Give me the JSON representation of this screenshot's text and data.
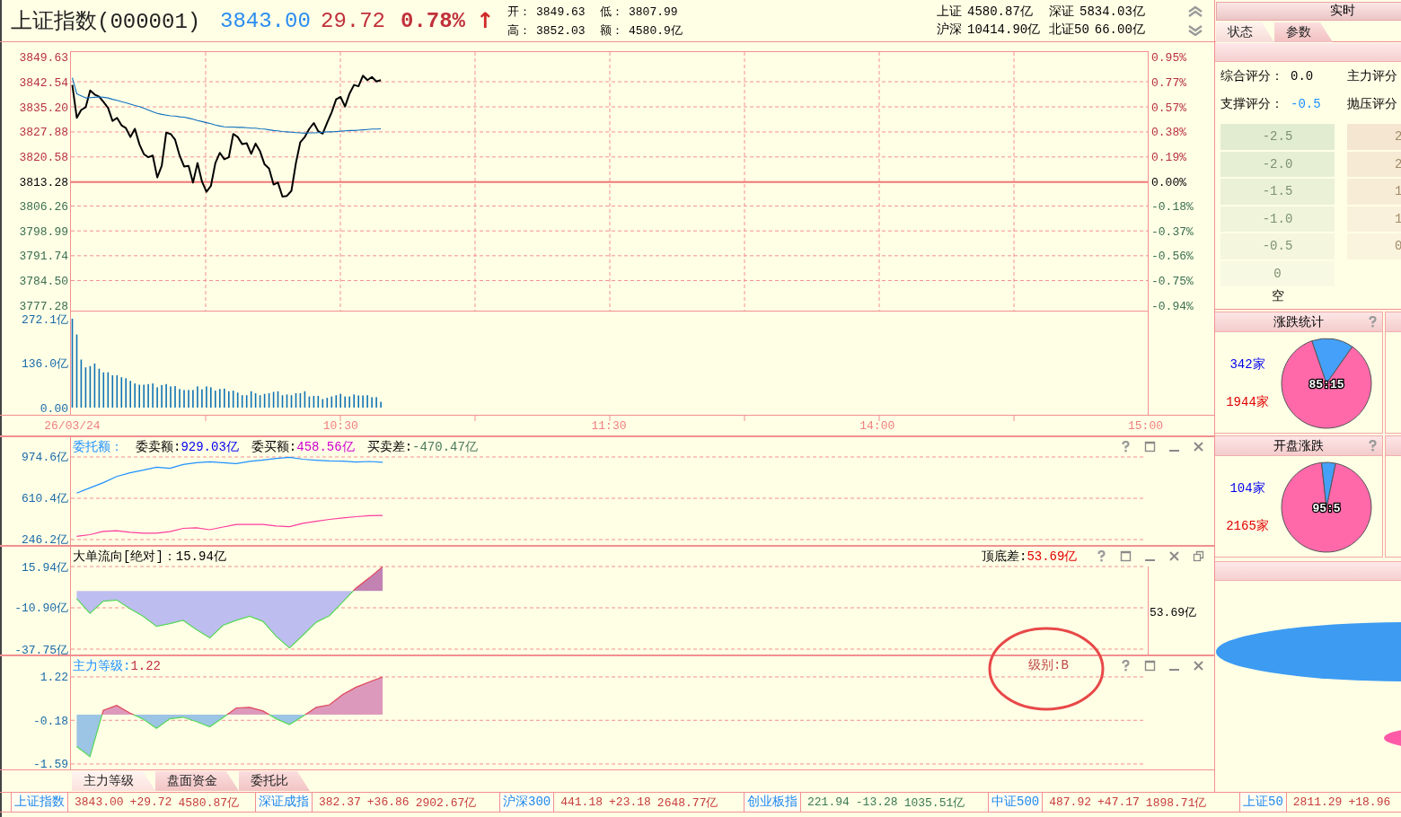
{
  "header": {
    "title": "上证指数(000001)",
    "price": "3843.00",
    "change": "29.72",
    "change_pct": "0.78%",
    "arrow": "↑",
    "stats": [
      {
        "label": "开：",
        "value": "3849.63"
      },
      {
        "label": "低：",
        "value": "3807.99"
      },
      {
        "label": "高：",
        "value": "3852.03"
      },
      {
        "label": "额：",
        "value": "4580.9亿"
      }
    ],
    "turnover": [
      {
        "label": "上证",
        "value": "4580.87亿"
      },
      {
        "label": "深证",
        "value": "5834.03亿"
      },
      {
        "label": "沪深",
        "value": "10414.90亿"
      },
      {
        "label": "北证50",
        "value": "66.00亿"
      }
    ]
  },
  "price_chart": {
    "right_axis": [
      "0.95%",
      "0.77%",
      "0.57%",
      "0.38%",
      "0.19%",
      "0.00%",
      "-0.18%",
      "-0.37%",
      "-0.56%",
      "-0.75%",
      "-0.94%"
    ],
    "chart_data": {
      "type": "line",
      "grid": true,
      "ylim": [
        3775.71,
        3851.33
      ],
      "yticks": [
        {
          "value": 3849.63,
          "label": "3849.63"
        },
        {
          "value": 3842.54,
          "label": "3842.54"
        },
        {
          "value": 3835.2,
          "label": "3835.20"
        },
        {
          "value": 3827.88,
          "label": "3827.88"
        },
        {
          "value": 3820.58,
          "label": "3820.58"
        },
        {
          "value": 3813.28,
          "label": "3813.28"
        },
        {
          "value": 3806.26,
          "label": "3806.26"
        },
        {
          "value": 3798.99,
          "label": "3798.99"
        },
        {
          "value": 3791.74,
          "label": "3791.74"
        },
        {
          "value": 3784.5,
          "label": "3784.50"
        },
        {
          "value": 3777.28,
          "label": "3777.28"
        }
      ],
      "ref_lines": [
        {
          "axis": "y",
          "value": 3813.28
        }
      ],
      "categories": [
        null,
        null,
        null,
        null,
        null,
        null,
        null,
        null,
        null,
        null,
        null,
        null,
        null,
        null,
        null,
        null,
        null,
        null,
        null,
        null,
        null,
        null,
        null,
        null,
        null,
        null,
        null,
        null,
        null,
        null,
        null,
        null,
        null,
        null,
        null,
        null,
        null,
        null,
        null,
        null,
        null,
        null,
        null,
        null,
        null,
        null,
        null,
        null,
        null,
        null,
        null,
        null,
        null,
        null,
        null,
        null,
        null,
        null,
        null,
        null,
        null,
        null,
        null,
        null,
        null,
        null,
        null,
        null,
        null,
        null,
        null,
        null,
        null,
        null,
        null,
        null,
        null,
        null,
        null,
        null,
        null,
        null,
        null,
        null,
        null,
        null,
        null,
        null,
        null,
        null,
        null,
        null,
        null,
        null,
        null,
        null,
        null,
        null,
        null,
        null,
        null,
        null,
        null,
        null,
        null,
        null,
        null,
        null,
        null,
        null,
        null,
        null,
        null,
        null,
        null,
        null,
        null,
        null,
        null,
        null,
        null,
        null,
        null,
        null,
        null,
        null,
        null,
        null,
        null,
        null,
        null,
        null,
        null,
        null,
        null,
        null,
        null,
        null,
        null,
        null,
        null,
        null,
        null,
        null,
        null,
        null,
        null,
        null,
        null,
        null,
        null,
        null,
        null,
        null,
        null,
        null,
        null,
        null,
        null,
        null,
        null,
        null,
        null,
        null,
        null,
        null,
        null,
        null,
        null,
        null,
        null,
        null,
        null,
        null,
        null,
        null,
        null,
        null,
        null,
        null,
        null,
        null,
        null,
        null,
        null,
        null,
        null,
        null,
        null,
        null,
        null,
        null,
        null,
        null,
        null,
        null,
        null,
        null,
        null,
        null,
        null,
        null,
        null,
        null,
        null,
        null,
        null,
        null,
        null,
        null,
        null,
        null,
        null,
        null,
        null,
        null,
        null,
        null,
        null,
        null,
        null,
        null,
        null,
        null,
        null,
        null,
        null,
        null,
        null,
        null,
        null,
        null,
        null,
        null,
        null,
        null,
        null,
        null,
        null,
        null,
        null
      ],
      "series": [
        {
          "color": "#000000",
          "values": [
            3841.6,
            3832.0,
            3834.3,
            3835.1,
            3840.0,
            3838.8,
            3838.2,
            3836.6,
            3834.9,
            3831.1,
            3832.0,
            3829.8,
            3829.0,
            3826.4,
            3828.8,
            3824.3,
            3821.4,
            3820.5,
            3821.0,
            3814.6,
            3818.0,
            3827.7,
            3827.3,
            3825.6,
            3821.0,
            3817.8,
            3818.0,
            3813.1,
            3818.8,
            3813.4,
            3810.4,
            3812.1,
            3818.8,
            3821.8,
            3819.9,
            3820.5,
            3827.3,
            3826.4,
            3824.3,
            3824.6,
            3821.5,
            3824.5,
            3822.2,
            3818.4,
            3817.2,
            3812.5,
            3813.1,
            3809.0,
            3809.2,
            3810.7,
            3818.8,
            3824.9,
            3826.4,
            3828.8,
            3830.5,
            3828.1,
            3827.4,
            3830.6,
            3833.6,
            3837.4,
            3838.1,
            3835.3,
            3839.1,
            3841.6,
            3841.2,
            3844.3,
            3843.0,
            3843.9,
            3842.6,
            3843.0,
            null,
            null,
            null,
            null,
            null,
            null,
            null,
            null,
            null,
            null,
            null,
            null,
            null,
            null,
            null,
            null,
            null,
            null,
            null,
            null,
            null,
            null,
            null,
            null,
            null,
            null,
            null,
            null,
            null,
            null,
            null,
            null,
            null,
            null,
            null,
            null,
            null,
            null,
            null,
            null,
            null,
            null,
            null,
            null,
            null,
            null,
            null,
            null,
            null,
            null,
            null,
            null,
            null,
            null,
            null,
            null,
            null,
            null,
            null,
            null,
            null,
            null,
            null,
            null,
            null,
            null,
            null,
            null,
            null,
            null,
            null,
            null,
            null,
            null,
            null,
            null,
            null,
            null,
            null,
            null,
            null,
            null,
            null,
            null,
            null,
            null,
            null,
            null,
            null,
            null,
            null,
            null,
            null,
            null,
            null,
            null,
            null,
            null,
            null,
            null,
            null,
            null,
            null,
            null,
            null,
            null,
            null,
            null,
            null,
            null,
            null,
            null,
            null,
            null,
            null,
            null,
            null,
            null,
            null,
            null,
            null,
            null,
            null,
            null,
            null,
            null,
            null,
            null,
            null,
            null,
            null,
            null,
            null,
            null,
            null,
            null,
            null,
            null,
            null,
            null,
            null,
            null,
            null,
            null,
            null,
            null,
            null,
            null,
            null,
            null,
            null,
            null,
            null,
            null,
            null,
            null,
            null,
            null,
            null,
            null,
            null,
            null,
            null,
            null,
            null,
            null,
            null,
            null,
            null,
            null,
            null
          ]
        },
        {
          "color": "#1070c0",
          "values": [
            3843.7,
            3839.0,
            3838.4,
            3837.8,
            3837.9,
            3838.0,
            3838.1,
            3838.0,
            3837.8,
            3837.4,
            3837.1,
            3836.7,
            3836.4,
            3836.0,
            3835.6,
            3835.3,
            3834.8,
            3834.3,
            3833.8,
            3833.3,
            3833.0,
            3832.8,
            3832.6,
            3832.5,
            3832.3,
            3832.2,
            3831.9,
            3831.6,
            3831.2,
            3830.9,
            3830.6,
            3830.3,
            3829.9,
            3829.6,
            3829.4,
            3829.3,
            3829.3,
            3829.2,
            3829.2,
            3829.1,
            3829.0,
            3829.0,
            3828.8,
            3828.7,
            3828.5,
            3828.3,
            3828.2,
            3828.0,
            3827.9,
            3827.8,
            3827.7,
            3827.6,
            3827.5,
            3827.6,
            3827.6,
            3827.7,
            3827.8,
            3827.9,
            3827.9,
            3828.0,
            3828.1,
            3828.2,
            3828.3,
            3828.3,
            3828.4,
            3828.5,
            3828.6,
            3828.7,
            3828.7,
            3828.8,
            null,
            null,
            null,
            null,
            null,
            null,
            null,
            null,
            null,
            null,
            null,
            null,
            null,
            null,
            null,
            null,
            null,
            null,
            null,
            null,
            null,
            null,
            null,
            null,
            null,
            null,
            null,
            null,
            null,
            null,
            null,
            null,
            null,
            null,
            null,
            null,
            null,
            null,
            null,
            null,
            null,
            null,
            null,
            null,
            null,
            null,
            null,
            null,
            null,
            null,
            null,
            null,
            null,
            null,
            null,
            null,
            null,
            null,
            null,
            null,
            null,
            null,
            null,
            null,
            null,
            null,
            null,
            null,
            null,
            null,
            null,
            null,
            null,
            null,
            null,
            null,
            null,
            null,
            null,
            null,
            null,
            null,
            null,
            null,
            null,
            null,
            null,
            null,
            null,
            null,
            null,
            null,
            null,
            null,
            null,
            null,
            null,
            null,
            null,
            null,
            null,
            null,
            null,
            null,
            null,
            null,
            null,
            null,
            null,
            null,
            null,
            null,
            null,
            null,
            null,
            null,
            null,
            null,
            null,
            null,
            null,
            null,
            null,
            null,
            null,
            null,
            null,
            null,
            null,
            null,
            null,
            null,
            null,
            null,
            null,
            null,
            null,
            null,
            null,
            null,
            null,
            null,
            null,
            null,
            null,
            null,
            null,
            null,
            null,
            null,
            null,
            null,
            null,
            null,
            null,
            null,
            null,
            null,
            null,
            null,
            null,
            null,
            null,
            null,
            null,
            null,
            null,
            null,
            null,
            null,
            null
          ]
        }
      ]
    }
  },
  "volume_chart": {
    "chart_data": {
      "type": "bar",
      "ylim": [
        0,
        272.1
      ],
      "yticks": [
        {
          "value": 272.1,
          "label": "272.1亿"
        },
        {
          "value": 136,
          "label": "136.0亿"
        },
        {
          "value": 0,
          "label": "0.00"
        }
      ],
      "categories": [
        "26/03/24",
        null,
        null,
        null,
        null,
        null,
        null,
        null,
        null,
        null,
        null,
        null,
        null,
        null,
        null,
        null,
        null,
        null,
        null,
        null,
        null,
        null,
        null,
        null,
        null,
        null,
        null,
        null,
        null,
        null,
        null,
        null,
        null,
        null,
        null,
        null,
        null,
        null,
        null,
        null,
        null,
        null,
        null,
        null,
        null,
        null,
        null,
        null,
        null,
        null,
        null,
        null,
        null,
        null,
        null,
        null,
        null,
        null,
        null,
        null,
        "10:30",
        null,
        null,
        null,
        null,
        null,
        null,
        null,
        null,
        null,
        null,
        null,
        null,
        null,
        null,
        null,
        null,
        null,
        null,
        null,
        null,
        null,
        null,
        null,
        null,
        null,
        null,
        null,
        null,
        null,
        null,
        null,
        null,
        null,
        null,
        null,
        null,
        null,
        null,
        null,
        null,
        null,
        null,
        null,
        null,
        null,
        null,
        null,
        null,
        null,
        null,
        null,
        null,
        null,
        null,
        null,
        null,
        null,
        null,
        null,
        "11:30",
        null,
        null,
        null,
        null,
        null,
        null,
        null,
        null,
        null,
        null,
        null,
        null,
        null,
        null,
        null,
        null,
        null,
        null,
        null,
        null,
        null,
        null,
        null,
        null,
        null,
        null,
        null,
        null,
        null,
        null,
        null,
        null,
        null,
        null,
        null,
        null,
        null,
        null,
        null,
        null,
        null,
        null,
        null,
        null,
        null,
        null,
        null,
        null,
        null,
        null,
        null,
        null,
        null,
        null,
        null,
        null,
        null,
        null,
        null,
        "14:00",
        null,
        null,
        null,
        null,
        null,
        null,
        null,
        null,
        null,
        null,
        null,
        null,
        null,
        null,
        null,
        null,
        null,
        null,
        null,
        null,
        null,
        null,
        null,
        null,
        null,
        null,
        null,
        null,
        null,
        null,
        null,
        null,
        null,
        null,
        null,
        null,
        null,
        null,
        null,
        null,
        null,
        null,
        null,
        null,
        null,
        null,
        null,
        null,
        null,
        null,
        null,
        null,
        null,
        null,
        null,
        null,
        null,
        null,
        null,
        "15:00"
      ],
      "series": [
        {
          "color": "#0f72b4",
          "values": [
            272,
            224,
            147,
            123,
            127,
            135,
            119,
            108,
            108,
            99,
            99,
            93,
            90,
            82,
            74,
            70,
            70,
            72,
            74,
            62,
            69,
            72,
            65,
            66,
            57,
            54,
            54,
            54,
            65,
            56,
            65,
            62,
            52,
            57,
            58,
            50,
            52,
            46,
            38,
            38,
            50,
            44,
            38,
            42,
            44,
            48,
            50,
            38,
            40,
            38,
            44,
            44,
            50,
            34,
            36,
            36,
            26,
            30,
            34,
            38,
            42,
            34,
            34,
            40,
            37,
            37,
            38,
            32,
            32,
            18,
            null,
            null,
            null,
            null,
            null,
            null,
            null,
            null,
            null,
            null,
            null,
            null,
            null,
            null,
            null,
            null,
            null,
            null,
            null,
            null,
            null,
            null,
            null,
            null,
            null,
            null,
            null,
            null,
            null,
            null,
            null,
            null,
            null,
            null,
            null,
            null,
            null,
            null,
            null,
            null,
            null,
            null,
            null,
            null,
            null,
            null,
            null,
            null,
            null,
            null,
            null,
            null,
            null,
            null,
            null,
            null,
            null,
            null,
            null,
            null,
            null,
            null,
            null,
            null,
            null,
            null,
            null,
            null,
            null,
            null,
            null,
            null,
            null,
            null,
            null,
            null,
            null,
            null,
            null,
            null,
            null,
            null,
            null,
            null,
            null,
            null,
            null,
            null,
            null,
            null,
            null,
            null,
            null,
            null,
            null,
            null,
            null,
            null,
            null,
            null,
            null,
            null,
            null,
            null,
            null,
            null,
            null,
            null,
            null,
            null,
            null,
            null,
            null,
            null,
            null,
            null,
            null,
            null,
            null,
            null,
            null,
            null,
            null,
            null,
            null,
            null,
            null,
            null,
            null,
            null,
            null,
            null,
            null,
            null,
            null,
            null,
            null,
            null,
            null,
            null,
            null,
            null,
            null,
            null,
            null,
            null,
            null,
            null,
            null,
            null,
            null,
            null,
            null,
            null,
            null,
            null,
            null,
            null,
            null,
            null,
            null,
            null,
            null,
            null,
            null,
            null,
            null,
            null,
            null,
            null,
            null
          ]
        }
      ]
    }
  },
  "order_panel": {
    "header": [
      {
        "kind": "label",
        "text": "委托额：",
        "color": "#1e90ff"
      },
      {
        "kind": "label",
        "text": "委卖额:",
        "color": "#000000"
      },
      {
        "kind": "value",
        "text": "929.03亿",
        "color": "#0000ee"
      },
      {
        "kind": "label",
        "text": "委买额:",
        "color": "#000000"
      },
      {
        "kind": "value",
        "text": "458.56亿",
        "color": "#cc00cc"
      },
      {
        "kind": "label",
        "text": "买卖差:",
        "color": "#000000"
      },
      {
        "kind": "value",
        "text": "-470.47亿",
        "color": "#4a7a5a"
      }
    ],
    "controls": [
      {
        "kind": "help"
      },
      {
        "kind": "maximize"
      },
      {
        "kind": "minimize"
      },
      {
        "kind": "close"
      }
    ],
    "chart_data": {
      "type": "line",
      "grid": true,
      "ylim": [
        194.7,
        1152.7
      ],
      "yticks": [
        {
          "value": 974.6,
          "label": "974.6亿"
        },
        {
          "value": 610.4,
          "label": "610.4亿"
        },
        {
          "value": 246.2,
          "label": "246.2亿"
        }
      ],
      "categories": [
        null,
        null,
        null,
        null,
        null,
        null,
        null,
        null,
        null,
        null,
        null,
        null,
        null,
        null,
        null,
        null,
        null,
        null,
        null,
        null,
        null,
        null,
        null,
        null,
        null,
        null,
        null,
        null,
        null,
        null,
        null,
        null,
        null,
        null,
        null,
        null,
        null,
        null,
        null,
        null,
        null,
        null,
        null,
        null,
        null,
        null,
        null,
        null,
        null,
        null,
        null,
        null,
        null,
        null,
        null,
        null,
        null,
        null,
        null,
        null,
        null,
        null,
        null,
        null,
        null,
        null,
        null,
        null,
        null,
        null,
        null,
        null,
        null,
        null,
        null,
        null,
        null,
        null,
        null,
        null,
        null
      ],
      "series": [
        {
          "color": "#1e90ff",
          "values": [
            656,
            702,
            748,
            803,
            835,
            858,
            885,
            874,
            909,
            924,
            932,
            924,
            916,
            936,
            948,
            962,
            972,
            955,
            946,
            940,
            937,
            930,
            935,
            929,
            null,
            null,
            null,
            null,
            null,
            null,
            null,
            null,
            null,
            null,
            null,
            null,
            null,
            null,
            null,
            null,
            null,
            null,
            null,
            null,
            null,
            null,
            null,
            null,
            null,
            null,
            null,
            null,
            null,
            null,
            null,
            null,
            null,
            null,
            null,
            null,
            null,
            null,
            null,
            null,
            null,
            null,
            null,
            null,
            null,
            null,
            null,
            null,
            null,
            null,
            null,
            null,
            null,
            null,
            null,
            null,
            null
          ]
        },
        {
          "color": "#ff3c9c",
          "values": [
            275,
            290,
            318,
            324,
            310,
            303,
            303,
            317,
            345,
            350,
            333,
            357,
            379,
            379,
            380,
            366,
            360,
            390,
            407,
            424,
            437,
            448,
            457,
            459,
            null,
            null,
            null,
            null,
            null,
            null,
            null,
            null,
            null,
            null,
            null,
            null,
            null,
            null,
            null,
            null,
            null,
            null,
            null,
            null,
            null,
            null,
            null,
            null,
            null,
            null,
            null,
            null,
            null,
            null,
            null,
            null,
            null,
            null,
            null,
            null,
            null,
            null,
            null,
            null,
            null,
            null,
            null,
            null,
            null,
            null,
            null,
            null,
            null,
            null,
            null,
            null,
            null,
            null,
            null,
            null,
            null
          ]
        }
      ]
    }
  },
  "flow_panel": {
    "header": [
      {
        "kind": "label",
        "text": "大单流向[绝对]：",
        "color": "#000000"
      },
      {
        "kind": "value",
        "text": "15.94亿",
        "color": "#000000"
      }
    ],
    "header_right": [
      {
        "kind": "label",
        "text": "顶底差:",
        "color": "#000000"
      },
      {
        "kind": "value",
        "text": "53.69亿",
        "color": "#e00000"
      }
    ],
    "right_label": "53.69亿",
    "controls": [
      {
        "kind": "help"
      },
      {
        "kind": "maximize"
      },
      {
        "kind": "minimize"
      },
      {
        "kind": "close"
      },
      {
        "kind": "restore"
      }
    ],
    "chart_data": {
      "type": "area",
      "grid": true,
      "ylim": [
        -41.54,
        29.07
      ],
      "yticks": [
        {
          "value": 15.94,
          "label": "15.94亿"
        },
        {
          "value": -10.9,
          "label": "-10.90亿"
        },
        {
          "value": -37.75,
          "label": "-37.75亿"
        }
      ],
      "categories": [
        null,
        null,
        null,
        null,
        null,
        null,
        null,
        null,
        null,
        null,
        null,
        null,
        null,
        null,
        null,
        null,
        null,
        null,
        null,
        null,
        null,
        null,
        null,
        null,
        null,
        null,
        null,
        null,
        null,
        null,
        null,
        null,
        null,
        null,
        null,
        null,
        null,
        null,
        null,
        null,
        null,
        null,
        null,
        null,
        null,
        null,
        null,
        null,
        null,
        null,
        null,
        null,
        null,
        null,
        null,
        null,
        null,
        null,
        null,
        null,
        null,
        null,
        null,
        null,
        null,
        null,
        null,
        null,
        null,
        null,
        null,
        null,
        null,
        null,
        null,
        null,
        null,
        null,
        null,
        null,
        null
      ],
      "series": [
        {
          "values": [
            -5,
            -14.5,
            -6.6,
            -5.8,
            -11.4,
            -16.5,
            -23,
            -21.2,
            -19,
            -25,
            -30.4,
            -22.3,
            -19,
            -16.4,
            -19.7,
            -29.5,
            -37,
            -28.7,
            -20.3,
            -16,
            -7,
            2,
            8.6,
            15.9,
            null,
            null,
            null,
            null,
            null,
            null,
            null,
            null,
            null,
            null,
            null,
            null,
            null,
            null,
            null,
            null,
            null,
            null,
            null,
            null,
            null,
            null,
            null,
            null,
            null,
            null,
            null,
            null,
            null,
            null,
            null,
            null,
            null,
            null,
            null,
            null,
            null,
            null,
            null,
            null,
            null,
            null,
            null,
            null,
            null,
            null,
            null,
            null,
            null,
            null,
            null,
            null,
            null,
            null,
            null,
            null,
            null
          ]
        }
      ]
    }
  },
  "grade_panel": {
    "header": [
      {
        "kind": "label",
        "text": "主力等级:",
        "color": "#1e90ff"
      },
      {
        "kind": "value",
        "text": "1.22",
        "color": "#c03040"
      }
    ],
    "note": {
      "text": "级别:B",
      "circled": true
    },
    "controls": [
      {
        "kind": "help"
      },
      {
        "kind": "maximize"
      },
      {
        "kind": "minimize"
      },
      {
        "kind": "close"
      }
    ],
    "chart_data": {
      "type": "area",
      "grid": true,
      "ylim": [
        -1.78,
        1.9
      ],
      "yticks": [
        {
          "value": 1.22,
          "label": "1.22"
        },
        {
          "value": -0.18,
          "label": "-0.18"
        },
        {
          "value": -1.59,
          "label": "-1.59"
        }
      ],
      "categories": [
        null,
        null,
        null,
        null,
        null,
        null,
        null,
        null,
        null,
        null,
        null,
        null,
        null,
        null,
        null,
        null,
        null,
        null,
        null,
        null,
        null,
        null,
        null,
        null,
        null,
        null,
        null,
        null,
        null,
        null,
        null,
        null,
        null,
        null,
        null,
        null,
        null,
        null,
        null,
        null,
        null,
        null,
        null,
        null,
        null,
        null,
        null,
        null,
        null,
        null,
        null,
        null,
        null,
        null,
        null,
        null,
        null,
        null,
        null,
        null,
        null,
        null,
        null,
        null,
        null,
        null,
        null,
        null,
        null,
        null,
        null,
        null,
        null,
        null,
        null,
        null,
        null,
        null,
        null,
        null,
        null
      ],
      "series": [
        {
          "values": [
            -1.03,
            -1.35,
            0.14,
            0.3,
            0.05,
            -0.14,
            -0.44,
            -0.13,
            -0.08,
            -0.22,
            -0.39,
            -0.09,
            0.22,
            0.24,
            0.12,
            -0.13,
            -0.32,
            -0.05,
            0.24,
            0.32,
            0.65,
            0.89,
            1.06,
            1.22,
            null,
            null,
            null,
            null,
            null,
            null,
            null,
            null,
            null,
            null,
            null,
            null,
            null,
            null,
            null,
            null,
            null,
            null,
            null,
            null,
            null,
            null,
            null,
            null,
            null,
            null,
            null,
            null,
            null,
            null,
            null,
            null,
            null,
            null,
            null,
            null,
            null,
            null,
            null,
            null,
            null,
            null,
            null,
            null,
            null,
            null,
            null,
            null,
            null,
            null,
            null,
            null,
            null,
            null,
            null,
            null,
            null
          ]
        }
      ]
    }
  },
  "bottom_tabs": [
    {
      "label": "主力等级",
      "selected": true
    },
    {
      "label": "盘面资金",
      "selected": false
    },
    {
      "label": "委托比",
      "selected": false
    }
  ],
  "side_panel": {
    "title": "实时",
    "tabs": [
      {
        "label": "状态",
        "selected": true
      },
      {
        "label": "参数",
        "selected": false
      }
    ],
    "scores": [
      {
        "label": "综合评分：",
        "value": "0.0",
        "color": "#000000"
      },
      {
        "label": "主力评分"
      },
      {
        "label": "支撑评分：",
        "value": "-0.5",
        "color": "#1e90ff"
      },
      {
        "label": "抛压评分"
      }
    ],
    "gauges": [
      {
        "labels": [
          "-2.5",
          "-2.0",
          "-1.5",
          "-1.0",
          "-0.5",
          "0"
        ],
        "caption": "空"
      },
      {
        "labels": [
          "2",
          "2",
          "1",
          "1",
          "0"
        ]
      }
    ],
    "breadth": [
      {
        "title": "涨跌统计",
        "fall": "342家",
        "rise": "1944家",
        "ratio": "85:15",
        "chart_data": {
          "type": "pie",
          "values": [
            85,
            15
          ],
          "colors": [
            "#ff69aa",
            "#44a0f8"
          ]
        }
      },
      {
        "title": "开盘涨跌",
        "fall": "104家",
        "rise": "2165家",
        "ratio": "95:5",
        "chart_data": {
          "type": "pie",
          "values": [
            95,
            5
          ],
          "colors": [
            "#ff69aa",
            "#44a0f8"
          ]
        }
      }
    ]
  },
  "ticker": [
    {
      "name": "上证指数",
      "price": "3843.00",
      "change": "+29.72",
      "amount": "4580.87亿",
      "color": "#c83c3c"
    },
    {
      "name": "深证成指",
      "price": "382.37",
      "change": "+36.86",
      "amount": "2902.67亿",
      "color": "#c83c3c"
    },
    {
      "name": "沪深300",
      "price": "441.18",
      "change": "+23.18",
      "amount": "2648.77亿",
      "color": "#c83c3c"
    },
    {
      "name": "创业板指",
      "price": "221.94",
      "change": "-13.28",
      "amount": "1035.51亿",
      "color": "#3a7a50"
    },
    {
      "name": "中证500",
      "price": "487.92",
      "change": "+47.17",
      "amount": "1898.71亿",
      "color": "#c83c3c"
    },
    {
      "name": "上证50",
      "price": "2811.29",
      "change": "+18.96",
      "color": "#c83c3c"
    }
  ]
}
